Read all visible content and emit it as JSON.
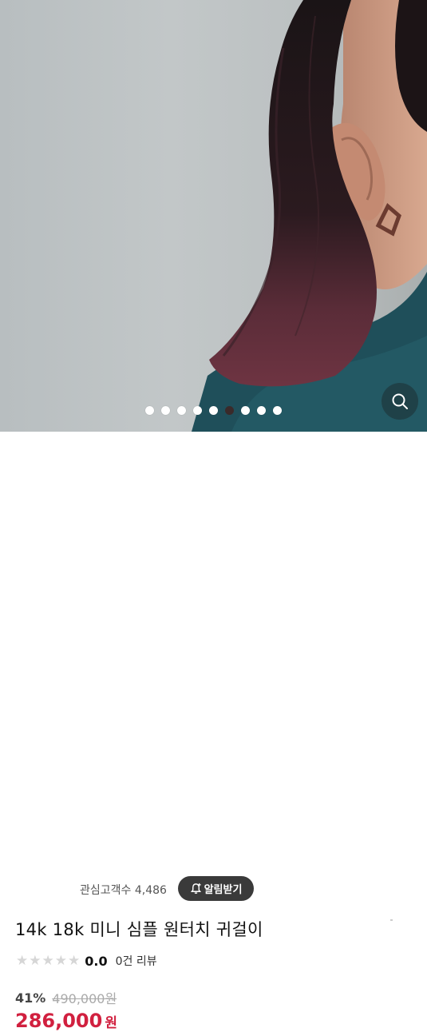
{
  "gallery": {
    "dot_count": 9,
    "active_index": 5,
    "zoom_icon": "search-icon"
  },
  "product": {
    "interest_label": "관심고객수 4,486",
    "notify_label": "알림받기",
    "notify_icon": "bell-plus-icon",
    "title": "14k 18k 미니 심플 원터치 귀걸이",
    "rating_value": 0,
    "rating_max": 5,
    "rating_text": "0.0",
    "review_text": "0건 리뷰",
    "discount": "41%",
    "original_price": "490,000원",
    "price": "286,000",
    "currency": "원"
  },
  "colors": {
    "price": "#d1203f",
    "notify_bg": "#3a3a3a",
    "star_empty": "#d6d6d6"
  }
}
